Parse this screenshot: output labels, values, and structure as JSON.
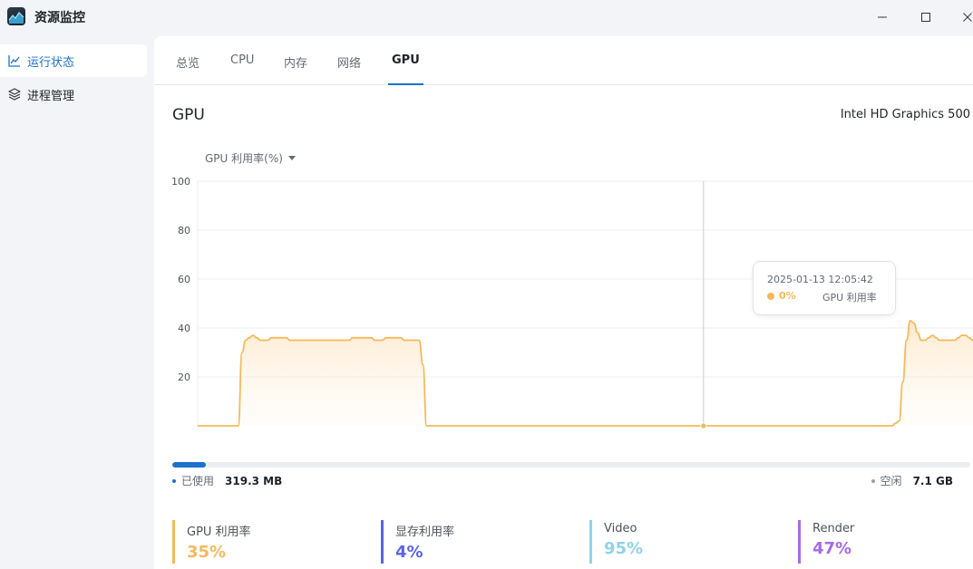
{
  "app": {
    "title": "资源监控"
  },
  "sidebar": {
    "items": [
      {
        "label": "运行状态",
        "icon": "chart-line-icon",
        "active": true
      },
      {
        "label": "进程管理",
        "icon": "layers-icon",
        "active": false
      }
    ]
  },
  "tabs": [
    {
      "label": "总览",
      "active": false
    },
    {
      "label": "CPU",
      "active": false
    },
    {
      "label": "内存",
      "active": false
    },
    {
      "label": "网络",
      "active": false
    },
    {
      "label": "GPU",
      "active": true
    }
  ],
  "gpu": {
    "title": "GPU",
    "model": "Intel HD Graphics 500",
    "metric_select": "GPU 利用率(%)"
  },
  "tooltip": {
    "time": "2025-01-13 12:05:42",
    "value": "0%",
    "series": "GPU 利用率"
  },
  "chart_data": {
    "type": "area",
    "title": "",
    "xlabel": "",
    "ylabel": "GPU 利用率(%)",
    "ylim": [
      0,
      100
    ],
    "yticks": [
      20,
      40,
      60,
      80,
      100
    ],
    "grid": true,
    "color": "#f5b95a",
    "series": [
      {
        "name": "GPU 利用率",
        "values": [
          0,
          0,
          0,
          0,
          0,
          0,
          0,
          0,
          0,
          0,
          0,
          0,
          30,
          35,
          36,
          37,
          36,
          35,
          35,
          35,
          36,
          36,
          36,
          36,
          36,
          35,
          35,
          35,
          35,
          35,
          35,
          35,
          35,
          35,
          35,
          35,
          35,
          35,
          35,
          35,
          35,
          35,
          36,
          36,
          36,
          36,
          36,
          36,
          35,
          35,
          35,
          36,
          36,
          36,
          36,
          36,
          35,
          35,
          35,
          35,
          35,
          25,
          0,
          0,
          0,
          0,
          0,
          0,
          0,
          0,
          0,
          0,
          0,
          0,
          0,
          0,
          0,
          0,
          0,
          0,
          0,
          0,
          0,
          0,
          0,
          0,
          0,
          0,
          0,
          0,
          0,
          0,
          0,
          0,
          0,
          0,
          0,
          0,
          0,
          0,
          0,
          0,
          0,
          0,
          0,
          0,
          0,
          0,
          0,
          0,
          0,
          0,
          0,
          0,
          0,
          0,
          0,
          0,
          0,
          0,
          0,
          0,
          0,
          0,
          0,
          0,
          0,
          0,
          0,
          0,
          0,
          0,
          0,
          0,
          0,
          0,
          0,
          0,
          0,
          0,
          0,
          0,
          0,
          0,
          0,
          0,
          0,
          0,
          0,
          0,
          0,
          0,
          0,
          0,
          0,
          0,
          0,
          0,
          0,
          0,
          0,
          0,
          0,
          0,
          0,
          0,
          0,
          0,
          0,
          0,
          0,
          0,
          0,
          0,
          0,
          0,
          0,
          0,
          0,
          0,
          0,
          0,
          0,
          0,
          0,
          0,
          0,
          0,
          0,
          1,
          2,
          18,
          35,
          43,
          42,
          38,
          35,
          35,
          36,
          37,
          36,
          35,
          35,
          35,
          35,
          35,
          36,
          37,
          37,
          36,
          35
        ]
      }
    ],
    "highlight_index": 137
  },
  "memory": {
    "used_label": "已使用",
    "used_value": "319.3 MB",
    "free_label": "空闲",
    "free_value": "7.1 GB",
    "used_fraction": 0.042
  },
  "stats": [
    {
      "label": "GPU 利用率",
      "value": "35%",
      "color": "#f5b95a"
    },
    {
      "label": "显存利用率",
      "value": "4%",
      "color": "#5b63e6"
    },
    {
      "label": "Video",
      "value": "95%",
      "color": "#8fd3e8"
    },
    {
      "label": "Render",
      "value": "47%",
      "color": "#a66be8"
    }
  ]
}
